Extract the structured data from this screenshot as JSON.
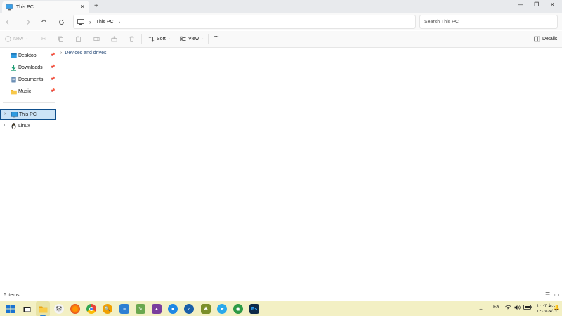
{
  "window": {
    "tab_title": "This PC",
    "tab_close_glyph": "✕",
    "new_tab_glyph": "+",
    "minimize_glyph": "—",
    "maximize_glyph": "❐",
    "close_glyph": "✕"
  },
  "address": {
    "location_icon": "computer-icon",
    "breadcrumbs": [
      "This PC"
    ],
    "search_placeholder": "Search This PC"
  },
  "commands": {
    "new_label": "New",
    "sort_label": "Sort",
    "view_label": "View",
    "more_glyph": "•••",
    "details_label": "Details"
  },
  "sidebar": {
    "quick_access": [
      {
        "label": "Desktop",
        "icon": "desktop-folder-icon",
        "pinned": true
      },
      {
        "label": "Downloads",
        "icon": "downloads-folder-icon",
        "pinned": true
      },
      {
        "label": "Documents",
        "icon": "documents-folder-icon",
        "pinned": true
      },
      {
        "label": "Music",
        "icon": "music-folder-icon",
        "pinned": true
      }
    ],
    "locations": [
      {
        "label": "This PC",
        "icon": "this-pc-icon",
        "selected": true
      },
      {
        "label": "Linux",
        "icon": "linux-penguin-icon",
        "selected": false
      }
    ]
  },
  "main": {
    "group_header": "Devices and drives"
  },
  "status": {
    "item_count": "6 items"
  },
  "taskbar": {
    "apps": [
      "start-icon",
      "taskview-icon",
      "file-explorer-icon",
      "app-icon",
      "firefox-icon",
      "chrome-icon",
      "search-app-icon",
      "notepad-icon",
      "app-icon",
      "app-icon",
      "app-icon",
      "app-icon",
      "app-icon",
      "app-icon",
      "telegram-icon",
      "app-icon",
      "photoshop-icon"
    ],
    "language": "Fa",
    "time": "۱۰:۰۳ ب.ظ",
    "date": "۱۴۰۵/۰۷/۰۶"
  },
  "colors": {
    "selection_bg": "#cce4f7",
    "selection_border": "#0f4f8c",
    "taskbar_bg": "#f3f0c4",
    "accent": "#2a7fd4"
  }
}
